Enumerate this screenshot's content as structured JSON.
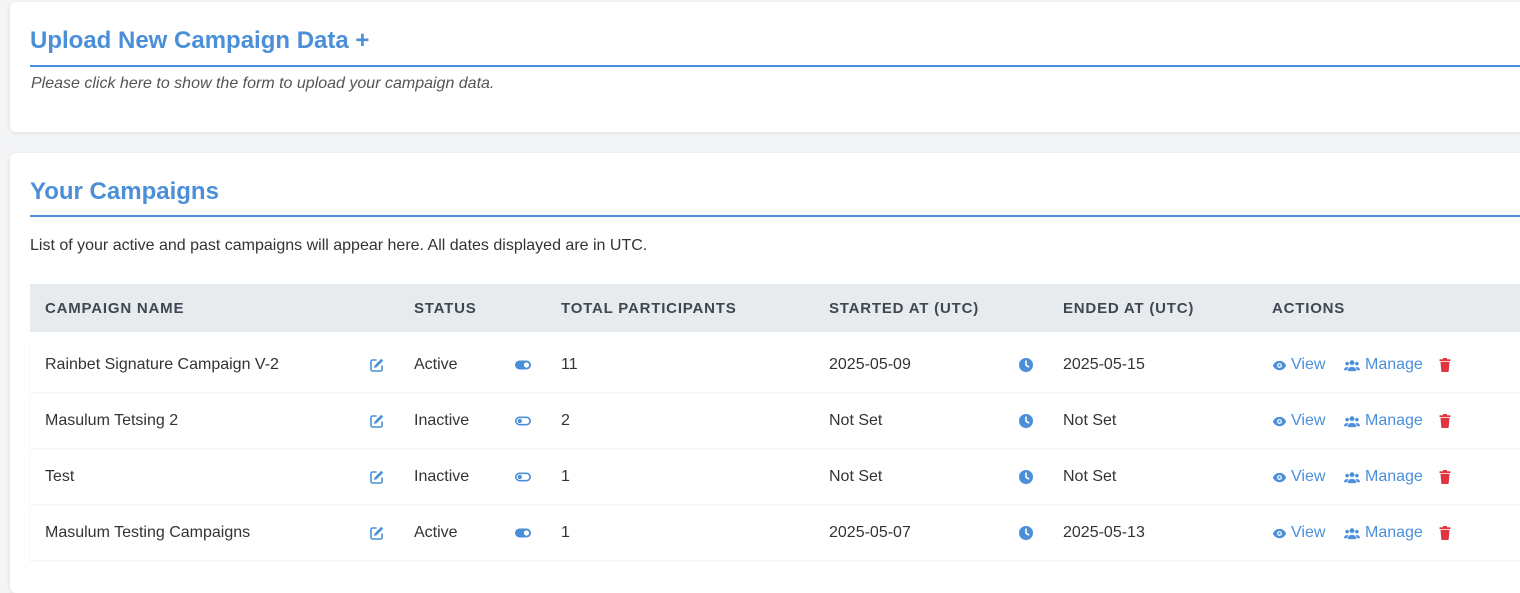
{
  "upload": {
    "title": "Upload New Campaign Data +",
    "hint": "Please click here to show the form to upload your campaign data."
  },
  "campaigns": {
    "title": "Your Campaigns",
    "description": "List of your active and past campaigns will appear here. All dates displayed are in UTC.",
    "columns": {
      "name": "CAMPAIGN NAME",
      "status": "STATUS",
      "participants": "TOTAL PARTICIPANTS",
      "started": "STARTED AT (UTC)",
      "ended": "ENDED AT (UTC)",
      "actions": "ACTIONS"
    },
    "actions": {
      "view": "View",
      "manage": "Manage"
    },
    "rows": [
      {
        "name": "Rainbet Signature Campaign V-2",
        "status": "Active",
        "participants": "11",
        "started": "2025-05-09",
        "ended": "2025-05-15"
      },
      {
        "name": "Masulum Tetsing 2",
        "status": "Inactive",
        "participants": "2",
        "started": "Not Set",
        "ended": "Not Set"
      },
      {
        "name": "Test",
        "status": "Inactive",
        "participants": "1",
        "started": "Not Set",
        "ended": "Not Set"
      },
      {
        "name": "Masulum Testing Campaigns",
        "status": "Active",
        "participants": "1",
        "started": "2025-05-07",
        "ended": "2025-05-13"
      }
    ]
  },
  "icons": {
    "edit": "edit-icon",
    "toggle_on": "toggle-on-icon",
    "toggle_off": "toggle-off-icon",
    "clock": "clock-icon",
    "view": "eye-icon",
    "manage": "users-icon",
    "delete": "trash-icon"
  },
  "colors": {
    "accent": "#4a8fd8",
    "danger": "#e0343f",
    "header_bg": "#e8ebee"
  }
}
